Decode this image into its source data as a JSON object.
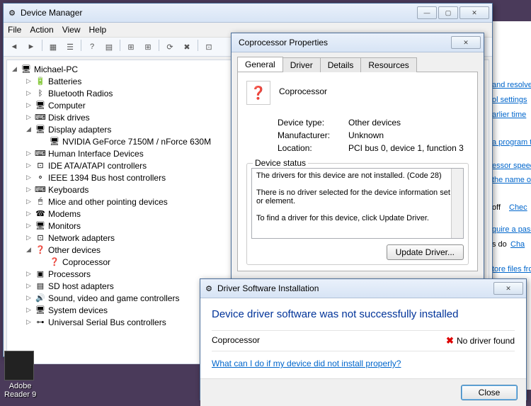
{
  "device_manager": {
    "title": "Device Manager",
    "menu": {
      "file": "File",
      "action": "Action",
      "view": "View",
      "help": "Help"
    },
    "root": "Michael-PC",
    "nodes": [
      {
        "label": "Batteries",
        "icon": "🔋",
        "indent": 1,
        "tw": "▷"
      },
      {
        "label": "Bluetooth Radios",
        "icon": "ᛒ",
        "indent": 1,
        "tw": "▷"
      },
      {
        "label": "Computer",
        "icon": "🖥",
        "indent": 1,
        "tw": "▷"
      },
      {
        "label": "Disk drives",
        "icon": "⌨",
        "indent": 1,
        "tw": "▷"
      },
      {
        "label": "Display adapters",
        "icon": "🖥",
        "indent": 1,
        "tw": "◢"
      },
      {
        "label": "NVIDIA GeForce 7150M / nForce 630M",
        "icon": "🖥",
        "indent": 2,
        "tw": ""
      },
      {
        "label": "Human Interface Devices",
        "icon": "⌨",
        "indent": 1,
        "tw": "▷"
      },
      {
        "label": "IDE ATA/ATAPI controllers",
        "icon": "⊡",
        "indent": 1,
        "tw": "▷"
      },
      {
        "label": "IEEE 1394 Bus host controllers",
        "icon": "⚬",
        "indent": 1,
        "tw": "▷"
      },
      {
        "label": "Keyboards",
        "icon": "⌨",
        "indent": 1,
        "tw": "▷"
      },
      {
        "label": "Mice and other pointing devices",
        "icon": "🖱",
        "indent": 1,
        "tw": "▷"
      },
      {
        "label": "Modems",
        "icon": "☎",
        "indent": 1,
        "tw": "▷"
      },
      {
        "label": "Monitors",
        "icon": "🖥",
        "indent": 1,
        "tw": "▷"
      },
      {
        "label": "Network adapters",
        "icon": "⊡",
        "indent": 1,
        "tw": "▷"
      },
      {
        "label": "Other devices",
        "icon": "❓",
        "indent": 1,
        "tw": "◢"
      },
      {
        "label": "Coprocessor",
        "icon": "❓",
        "indent": 2,
        "tw": ""
      },
      {
        "label": "Processors",
        "icon": "▣",
        "indent": 1,
        "tw": "▷"
      },
      {
        "label": "SD host adapters",
        "icon": "▤",
        "indent": 1,
        "tw": "▷"
      },
      {
        "label": "Sound, video and game controllers",
        "icon": "🔊",
        "indent": 1,
        "tw": "▷"
      },
      {
        "label": "System devices",
        "icon": "🖥",
        "indent": 1,
        "tw": "▷"
      },
      {
        "label": "Universal Serial Bus controllers",
        "icon": "⊶",
        "indent": 1,
        "tw": "▷"
      }
    ]
  },
  "properties": {
    "title": "Coprocessor Properties",
    "tabs": {
      "general": "General",
      "driver": "Driver",
      "details": "Details",
      "resources": "Resources"
    },
    "devname": "Coprocessor",
    "rows": {
      "type_l": "Device type:",
      "type_v": "Other devices",
      "mfr_l": "Manufacturer:",
      "mfr_v": "Unknown",
      "loc_l": "Location:",
      "loc_v": "PCI bus 0, device 1, function 3"
    },
    "status_legend": "Device status",
    "status1": "The drivers for this device are not installed. (Code 28)",
    "status2": "There is no driver selected for the device information set or element.",
    "status3": "To find a driver for this device, click Update Driver.",
    "update_btn": "Update Driver..."
  },
  "driver_install": {
    "title": "Driver Software Installation",
    "message": "Device driver software was not successfully installed",
    "row_name": "Coprocessor",
    "row_status": "No driver found",
    "help_link": "What can I do if my device did not install properly?",
    "close_btn": "Close"
  },
  "right_fragments": [
    "and resolve i",
    "ol settings",
    "arlier time",
    "a program th",
    "essor speed",
    "the name of",
    "off",
    "Chec",
    "quire a passw",
    "s do",
    "Cha",
    "tore files fro"
  ],
  "desktop": {
    "adobe": "Adobe",
    "reader": "Reader 9"
  }
}
